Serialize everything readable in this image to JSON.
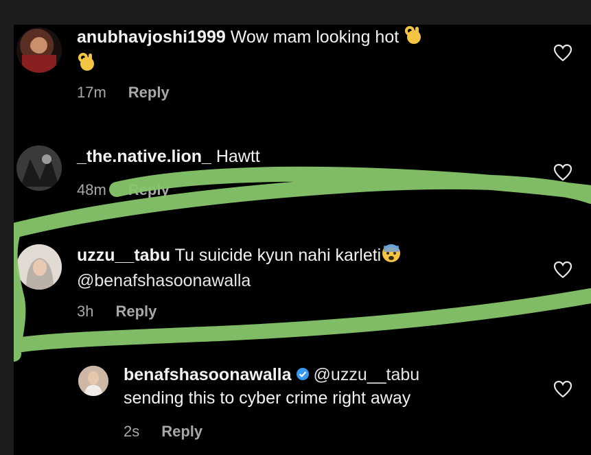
{
  "comments": [
    {
      "username": "anubhavjoshi1999",
      "text": "Wow mam looking hot",
      "emoji": "ok-hand-emoji",
      "time": "17m",
      "reply_label": "Reply"
    },
    {
      "username": "_the.native.lion_",
      "text": "Hawtt",
      "time": "48m",
      "reply_label": "Reply"
    },
    {
      "username": "uzzu__tabu",
      "text": "Tu suicide kyun nahi karleti",
      "emoji": "fearful-face-emoji",
      "mention": "@benafshasoonawalla",
      "time": "3h",
      "reply_label": "Reply"
    }
  ],
  "reply": {
    "username": "benafshasoonawalla",
    "verified": true,
    "mention": "@uzzu__tabu",
    "text": "sending this to cyber crime right away",
    "time": "2s",
    "reply_label": "Reply"
  },
  "colors": {
    "background": "#000000",
    "outer": "#1c1c1c",
    "text": "#f2f2f2",
    "secondary": "#a8a8a8",
    "highlight_stroke": "#86c66a",
    "verified_badge": "#3897f0"
  }
}
